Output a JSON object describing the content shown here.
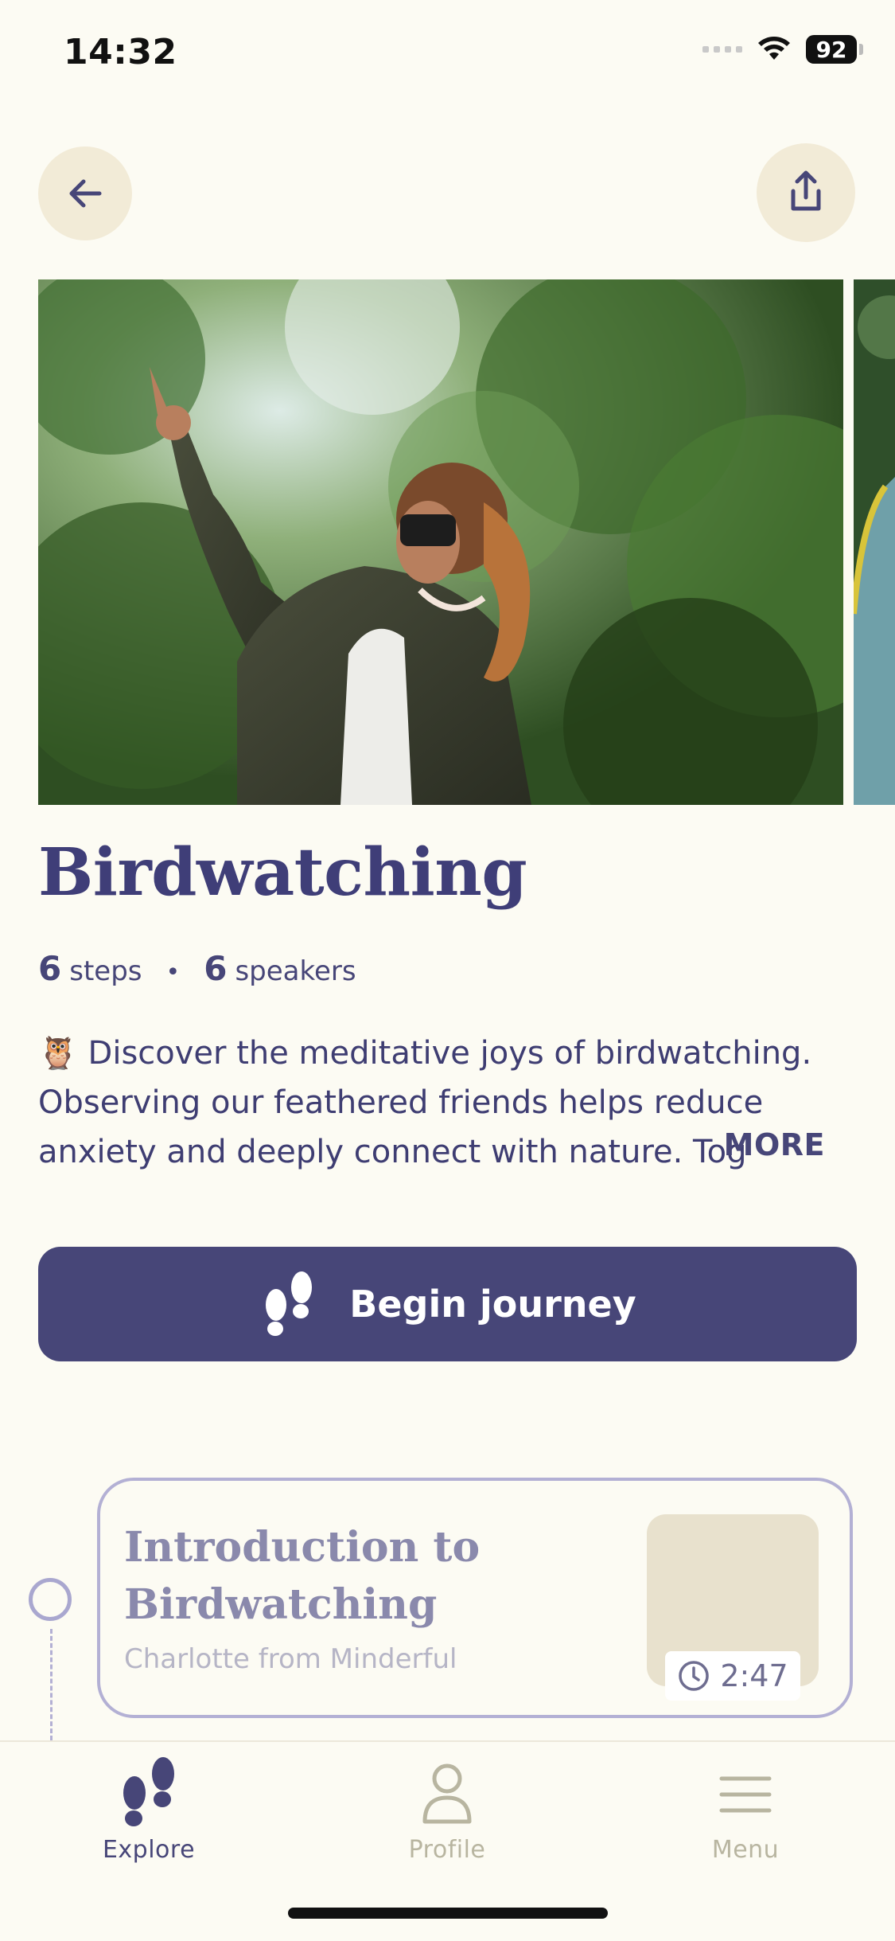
{
  "status_bar": {
    "time": "14:32",
    "battery": "92"
  },
  "header": {
    "back_icon": "arrow-left-icon",
    "share_icon": "share-icon"
  },
  "journey": {
    "title": "Birdwatching",
    "steps_count": "6",
    "steps_label": "steps",
    "separator": "•",
    "speakers_count": "6",
    "speakers_label": "speakers",
    "description_emoji": "🦉",
    "description": "Discover the meditative joys of birdwatching. Observing our feathered friends helps reduce anxiety and deeply connect with nature. Tog",
    "more_label": "MORE",
    "begin_label": "Begin journey"
  },
  "steps": [
    {
      "title": "Introduction to Birdwatching",
      "speaker": "Charlotte from Minderful",
      "duration": "2:47"
    }
  ],
  "bottom_nav": {
    "items": [
      {
        "label": "Explore",
        "icon": "footprints-icon",
        "active": true
      },
      {
        "label": "Profile",
        "icon": "person-icon",
        "active": false
      },
      {
        "label": "Menu",
        "icon": "menu-icon",
        "active": false
      }
    ]
  },
  "colors": {
    "background": "#FCFBF3",
    "primary": "#474678",
    "circle_button": "#F2EBD7",
    "inactive_nav": "#B8B5A0"
  }
}
